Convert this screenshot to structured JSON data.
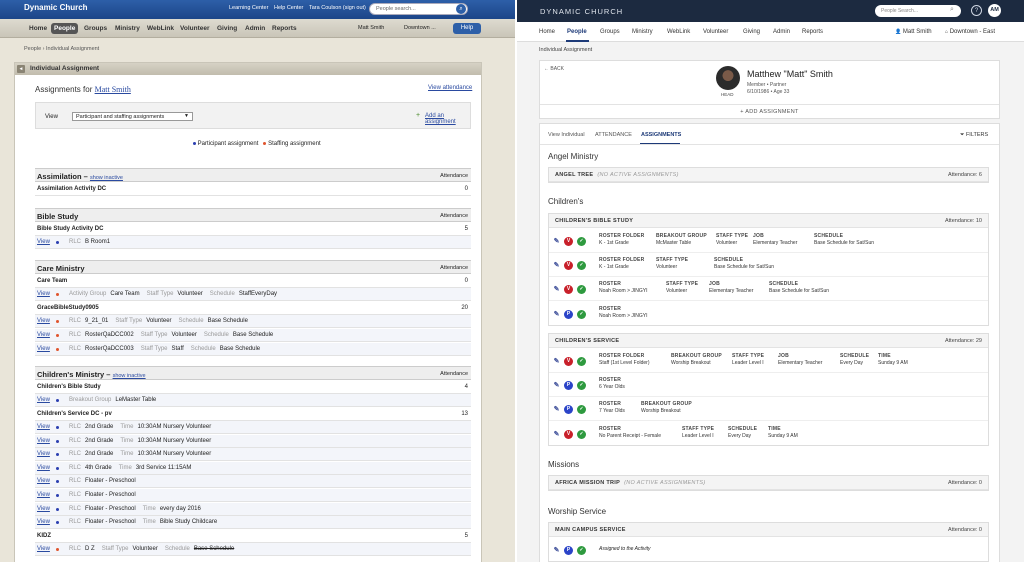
{
  "left": {
    "brand": "Dynamic Church",
    "top_links": [
      "Learning Center",
      "Help Center",
      "Tara Coulson (sign out)"
    ],
    "search_placeholder": "People search...",
    "nav": [
      "Home",
      "People",
      "Groups",
      "Ministry",
      "WebLink",
      "Volunteer",
      "Giving",
      "Admin",
      "Reports"
    ],
    "nav_active": "People",
    "user": "Matt Smith",
    "campus": "Downtown ...",
    "help": "Help",
    "breadcrumb": "People › Individual Assignment",
    "panel_title": "Individual Assignment",
    "assignments_for": "Assignments for",
    "person": "Matt Smith",
    "view_attendance": "View attendance",
    "view_label": "View",
    "view_select": "Participant and staffing assignments",
    "add_assignment": "Add an assignment",
    "legend": [
      "Participant assignment",
      "Staffing assignment"
    ],
    "show_inactive": "show inactive",
    "attendance_label": "Attendance",
    "view_link": "View",
    "sections": {
      "assimilation": {
        "title": "Assimilation",
        "rows": [
          {
            "name": "Assimilation Activity DC",
            "count": "0"
          }
        ]
      },
      "bible_study": {
        "title": "Bible Study",
        "rows": [
          {
            "name": "Bible Study Activity DC",
            "count": "5"
          },
          {
            "k1": "RLC",
            "v1": "B Room1"
          }
        ]
      },
      "care": {
        "title": "Care Ministry",
        "care_team": {
          "name": "Care Team",
          "count": "0"
        },
        "care_detail": {
          "k1": "Activity Group",
          "v1": "Care Team",
          "k2": "Staff Type",
          "v2": "Volunteer",
          "k3": "Schedule",
          "v3": "StaffEveryDay"
        },
        "grace": {
          "name": "GraceBibleStudy0905",
          "count": "20"
        },
        "grace_rows": [
          {
            "k1": "RLC",
            "v1": "9_21_01",
            "k2": "Staff Type",
            "v2": "Volunteer",
            "k3": "Schedule",
            "v3": "Base Schedule"
          },
          {
            "k1": "RLC",
            "v1": "RosterQaDCC002",
            "k2": "Staff Type",
            "v2": "Volunteer",
            "k3": "Schedule",
            "v3": "Base Schedule"
          },
          {
            "k1": "RLC",
            "v1": "RosterQaDCC003",
            "k2": "Staff Type",
            "v2": "Staff",
            "k3": "Schedule",
            "v3": "Base Schedule"
          }
        ]
      },
      "childrens": {
        "title": "Children's Ministry",
        "cbs": {
          "name": "Children's Bible Study",
          "count": "4"
        },
        "cbs_row": {
          "k1": "Breakout Group",
          "v1": "LeMaster Table"
        },
        "service": {
          "name": "Children's Service DC - pv",
          "count": "13"
        },
        "service_rows": [
          {
            "k1": "RLC",
            "v1": "2nd Grade",
            "k2": "Time",
            "v2": "10:30AM Nursery Volunteer"
          },
          {
            "k1": "RLC",
            "v1": "2nd Grade",
            "k2": "Time",
            "v2": "10:30AM Nursery Volunteer"
          },
          {
            "k1": "RLC",
            "v1": "2nd Grade",
            "k2": "Time",
            "v2": "10:30AM Nursery Volunteer"
          },
          {
            "k1": "RLC",
            "v1": "4th Grade",
            "k2": "Time",
            "v2": "3rd Service 11:15AM"
          },
          {
            "k1": "RLC",
            "v1": "Floater - Preschool"
          },
          {
            "k1": "RLC",
            "v1": "Floater - Preschool"
          },
          {
            "k1": "RLC",
            "v1": "Floater - Preschool",
            "k2": "Time",
            "v2": "every day 2016"
          },
          {
            "k1": "RLC",
            "v1": "Floater - Preschool",
            "k2": "Time",
            "v2": "Bible Study Childcare"
          }
        ],
        "kidz": {
          "name": "KIDZ",
          "count": "5"
        },
        "kidz_row": {
          "k1": "RLC",
          "v1": "D Z",
          "k2": "Staff Type",
          "v2": "Volunteer",
          "k3": "Schedule",
          "v3": "Base Schedule"
        }
      }
    }
  },
  "right": {
    "brand": "DYNAMIC CHURCH",
    "search_placeholder": "People Search...",
    "avatar": "AM",
    "nav": [
      "Home",
      "People",
      "Groups",
      "Ministry",
      "WebLink",
      "Volunteer",
      "Giving",
      "Admin",
      "Reports"
    ],
    "nav_active": "People",
    "user": "Matt Smith",
    "campus": "Downtown - East",
    "breadcrumb": "Individual Assignment",
    "back": "BACK",
    "head_label": "HEAD",
    "name": "Matthew \"Matt\" Smith",
    "role": "Member • Partner",
    "dob": "6/10/1986 • Age 33",
    "add_assignment": "+ ADD ASSIGNMENT",
    "tabs": [
      "View Individual",
      "ATTENDANCE",
      "ASSIGNMENTS"
    ],
    "tab_active": "ASSIGNMENTS",
    "filters": "FILTERS",
    "no_active": "(NO ACTIVE ASSIGNMENTS)",
    "groups": {
      "angel": {
        "title": "Angel Ministry",
        "box": {
          "title": "ANGEL TREE",
          "att": "Attendance: 6"
        }
      },
      "childrens": {
        "title": "Children's",
        "cbs": {
          "title": "CHILDREN'S BIBLE STUDY",
          "att": "Attendance: 10",
          "rows": [
            {
              "c1k": "ROSTER FOLDER",
              "c1v": "K - 1st Grade",
              "c2k": "BREAKOUT GROUP",
              "c2v": "McMaster Table",
              "c3k": "STAFF TYPE",
              "c3v": "Volunteer",
              "c4k": "JOB",
              "c4v": "Elementary Teacher",
              "c5k": "SCHEDULE",
              "c5v": "Base Schedule for Sat/Sun"
            },
            {
              "c1k": "ROSTER FOLDER",
              "c1v": "K - 1st Grade",
              "c2k": "STAFF TYPE",
              "c2v": "Volunteer",
              "c3k": "SCHEDULE",
              "c3v": "Base Schedule for Sat/Sun"
            },
            {
              "c1k": "ROSTER",
              "c1v": "Noah Room > JINGYI",
              "c2k": "STAFF TYPE",
              "c2v": "Volunteer",
              "c3k": "JOB",
              "c3v": "Elementary Teacher",
              "c4k": "SCHEDULE",
              "c4v": "Base Schedule for Sat/Sun"
            },
            {
              "c1k": "ROSTER",
              "c1v": "Noah Room > JINGYI"
            }
          ]
        },
        "cs": {
          "title": "CHILDREN'S SERVICE",
          "att": "Attendance: 29",
          "rows": [
            {
              "c1k": "ROSTER FOLDER",
              "c1v": "Staff (1st Level Folder)",
              "c2k": "BREAKOUT GROUP",
              "c2v": "Worship Breakout",
              "c3k": "STAFF TYPE",
              "c3v": "Leader Level I",
              "c4k": "JOB",
              "c4v": "Elementary Teacher",
              "c5k": "SCHEDULE",
              "c5v": "Every Day",
              "c6k": "TIME",
              "c6v": "Sunday 9 AM"
            },
            {
              "c1k": "ROSTER",
              "c1v": "6 Year Olds"
            },
            {
              "c1k": "ROSTER",
              "c1v": "7 Year Olds",
              "c2k": "BREAKOUT GROUP",
              "c2v": "Worship Breakout"
            },
            {
              "c1k": "ROSTER",
              "c1v": "No Parent Receipt - Female",
              "c2k": "STAFF TYPE",
              "c2v": "Leader Level I",
              "c3k": "SCHEDULE",
              "c3v": "Every Day",
              "c4k": "TIME",
              "c4v": "Sunday 9 AM"
            }
          ]
        }
      },
      "missions": {
        "title": "Missions",
        "box": {
          "title": "AFRICA MISSION TRIP",
          "att": "Attendance: 0"
        }
      },
      "worship": {
        "title": "Worship Service",
        "box": {
          "title": "MAIN CAMPUS SERVICE",
          "att": "Attendance: 0",
          "row_text": "Assigned to the Activity"
        }
      }
    }
  }
}
